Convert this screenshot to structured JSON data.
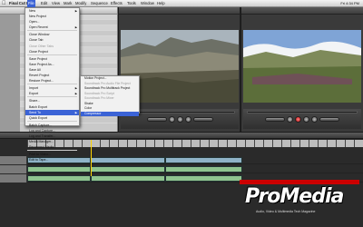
{
  "menubar": {
    "app": "Final Cut Pro",
    "items": [
      "File",
      "Edit",
      "View",
      "Mark",
      "Modify",
      "Sequence",
      "Effects",
      "Tools",
      "Window",
      "Help"
    ],
    "active": "File",
    "clock": "Fri 4:34 PM"
  },
  "file_menu": {
    "items": [
      {
        "label": "New",
        "disabled": false,
        "submenu": true
      },
      {
        "label": "New Project",
        "disabled": false
      },
      {
        "label": "Open...",
        "disabled": false
      },
      {
        "label": "Open Recent",
        "disabled": false,
        "submenu": true
      },
      {
        "label": "Close Window",
        "disabled": false
      },
      {
        "label": "Close Tab",
        "disabled": false
      },
      {
        "label": "Close Other Tabs",
        "disabled": true
      },
      {
        "label": "Close Project",
        "disabled": false
      },
      {
        "label": "Save Project",
        "disabled": false
      },
      {
        "label": "Save Project As...",
        "disabled": false
      },
      {
        "label": "Save All",
        "disabled": false
      },
      {
        "label": "Revert Project",
        "disabled": false
      },
      {
        "label": "Restore Project...",
        "disabled": false
      },
      {
        "label": "Import",
        "disabled": false,
        "submenu": true
      },
      {
        "label": "Export",
        "disabled": false,
        "submenu": true
      },
      {
        "label": "Share...",
        "disabled": false
      },
      {
        "label": "Batch Export",
        "disabled": false
      },
      {
        "label": "Send To",
        "disabled": false,
        "submenu": true,
        "selected": true
      },
      {
        "label": "Quick Export",
        "disabled": false
      },
      {
        "label": "Batch Capture...",
        "disabled": false
      },
      {
        "label": "Log and Capture...",
        "disabled": false
      },
      {
        "label": "Log and Transfer...",
        "disabled": false
      },
      {
        "label": "Media Manager...",
        "disabled": false
      },
      {
        "label": "Reconnect Media...",
        "disabled": false
      },
      {
        "label": "Print to Video...",
        "disabled": false
      },
      {
        "label": "Edit to Tape...",
        "disabled": false
      }
    ]
  },
  "send_to_menu": {
    "items": [
      {
        "label": "Motion Project...",
        "disabled": false
      },
      {
        "label": "Soundtrack Pro Audio File Project",
        "disabled": true
      },
      {
        "label": "Soundtrack Pro Multitrack Project",
        "disabled": false
      },
      {
        "label": "Soundtrack Pro Script",
        "disabled": true
      },
      {
        "label": "Soundtrack Pro Mixer",
        "disabled": true
      },
      {
        "label": "Shake",
        "disabled": false
      },
      {
        "label": "Color",
        "disabled": false
      },
      {
        "label": "Compressor",
        "disabled": false,
        "selected": true
      }
    ]
  },
  "watermark": {
    "logo": "ProMedia",
    "tagline": "Audio, Video & Multimedia Tech Magazine"
  },
  "colors": {
    "menu_highlight": "#3b63d6",
    "brand_red": "#cc0000"
  }
}
